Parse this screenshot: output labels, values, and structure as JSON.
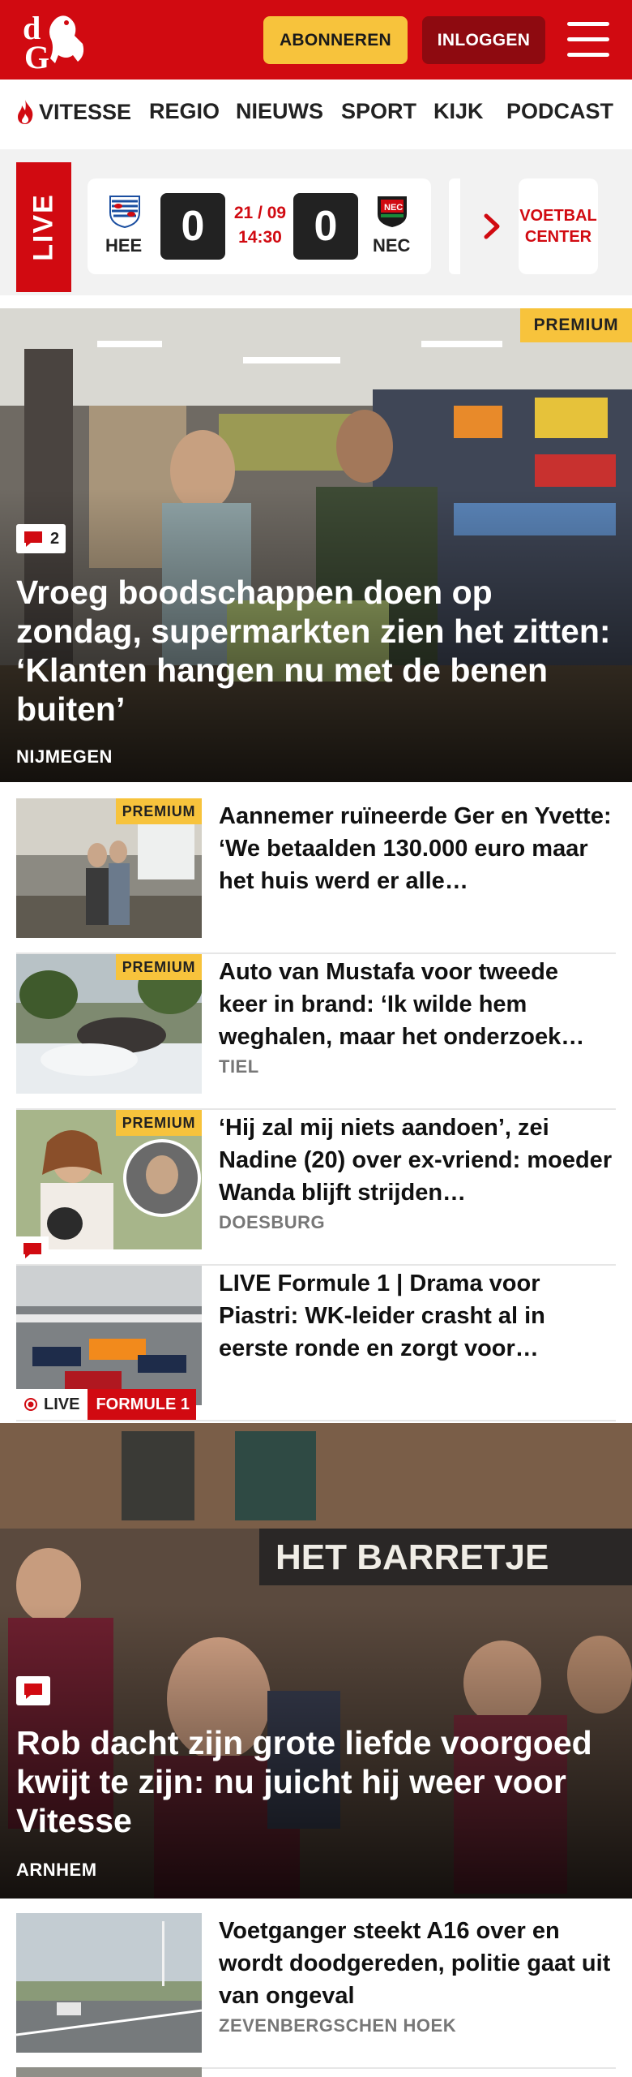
{
  "header": {
    "brand": "dG",
    "subscribe_label": "ABONNEREN",
    "login_label": "INLOGGEN",
    "menu_icon": "hamburger-icon",
    "accent_color": "#d10a11",
    "subscribe_color": "#f7c33c"
  },
  "nav": {
    "items": [
      {
        "label": "VITESSE",
        "icon": "flame-icon"
      },
      {
        "label": "REGIO"
      },
      {
        "label": "NIEUWS"
      },
      {
        "label": "SPORT"
      },
      {
        "label": "KIJK"
      },
      {
        "label": "PODCAST"
      }
    ]
  },
  "live_score": {
    "live_label": "LIVE",
    "home_team": "HEE",
    "home_score": "0",
    "date": "21 / 09",
    "time": "14:30",
    "away_score": "0",
    "away_team": "NEC",
    "voetbal_center_label": "VOETBAL CENTER"
  },
  "articles": {
    "hero1": {
      "title": "Vroeg boodschappen doen op zondag, supermarkten zien het zitten: ‘Klanten hangen nu met de benen buiten’",
      "location": "NIJMEGEN",
      "comments": "2",
      "premium": "PREMIUM"
    },
    "list1": [
      {
        "title": "Aannemer ruïneerde Ger en Yvette: ‘We betaalden 130.000 euro maar het huis werd er alle…",
        "location": "",
        "premium": "PREMIUM"
      },
      {
        "title": "Auto van Mustafa voor tweede keer in brand: ‘Ik wilde hem weghalen, maar het onderzoek…",
        "location": "TIEL",
        "premium": "PREMIUM"
      },
      {
        "title": "‘Hij zal mij niets aandoen’, zei Nadine (20) over ex-vriend: moeder Wanda blijft strijden…",
        "location": "DOESBURG",
        "premium": "PREMIUM"
      },
      {
        "title": "LIVE Formule 1 | Drama voor Piastri: WK-leider crasht al in eerste ronde en zorgt voor…",
        "location": "",
        "live_label": "LIVE",
        "category": "FORMULE 1"
      }
    ],
    "hero2": {
      "title": "Rob dacht zijn grote liefde voorgoed kwijt te zijn: nu juicht hij weer voor Vitesse",
      "location": "ARNHEM"
    },
    "list2": [
      {
        "title": "Voetganger steekt A16 over en wordt doodgereden, politie gaat uit van ongeval",
        "location": "ZEVENBERGSCHEN HOEK"
      }
    ]
  }
}
